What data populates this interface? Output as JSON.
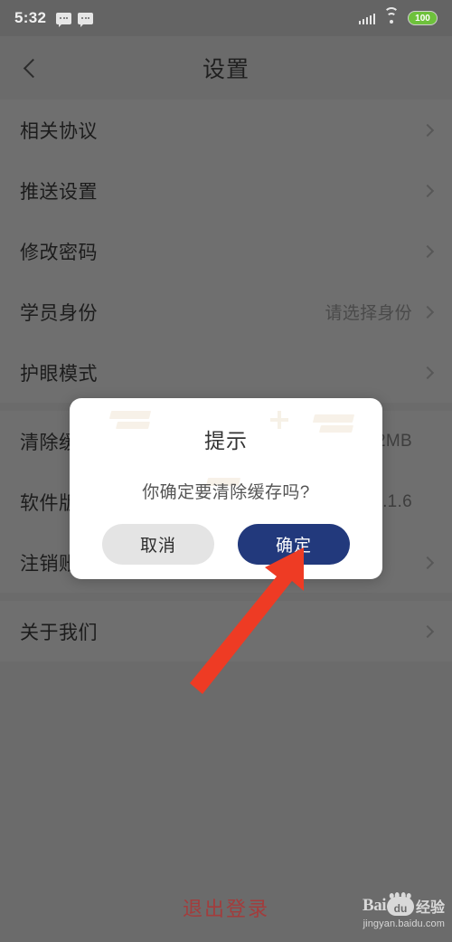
{
  "status_bar": {
    "time": "5:32",
    "battery_level": "100",
    "icons": [
      "message-bubble-icon",
      "message-bubble-icon",
      "signal-bars-icon",
      "wifi-icon",
      "battery-icon"
    ]
  },
  "navbar": {
    "title": "设置",
    "back_icon": "chevron-left-icon"
  },
  "groups": [
    {
      "rows": [
        {
          "label": "相关协议",
          "value": "",
          "chevron": true
        },
        {
          "label": "推送设置",
          "value": "",
          "chevron": true
        },
        {
          "label": "修改密码",
          "value": "",
          "chevron": true
        },
        {
          "label": "学员身份",
          "value": "请选择身份",
          "chevron": true
        },
        {
          "label": "护眼模式",
          "value": "",
          "chevron": true
        }
      ]
    },
    {
      "rows": [
        {
          "label": "清除缓存",
          "value": "0.72MB",
          "chevron": false
        },
        {
          "label": "软件版本",
          "value": "4.1.6",
          "chevron": false
        },
        {
          "label": "注销账号",
          "value": "",
          "chevron": true
        }
      ]
    },
    {
      "rows": [
        {
          "label": "关于我们",
          "value": "",
          "chevron": true
        }
      ]
    }
  ],
  "logout": {
    "label": "退出登录",
    "color": "#a33c3c"
  },
  "dialog": {
    "title": "提示",
    "message": "你确定要清除缓存吗?",
    "cancel_label": "取消",
    "confirm_label": "确定",
    "confirm_color": "#22397c",
    "cancel_color": "#e4e4e4"
  },
  "annotation": {
    "arrow_color": "#ee3b24",
    "arrow_icon": "arrow-pointer-icon"
  },
  "watermark": {
    "brand": "Bai",
    "paw_text": "du",
    "suffix": "经验",
    "url": "jingyan.baidu.com"
  }
}
